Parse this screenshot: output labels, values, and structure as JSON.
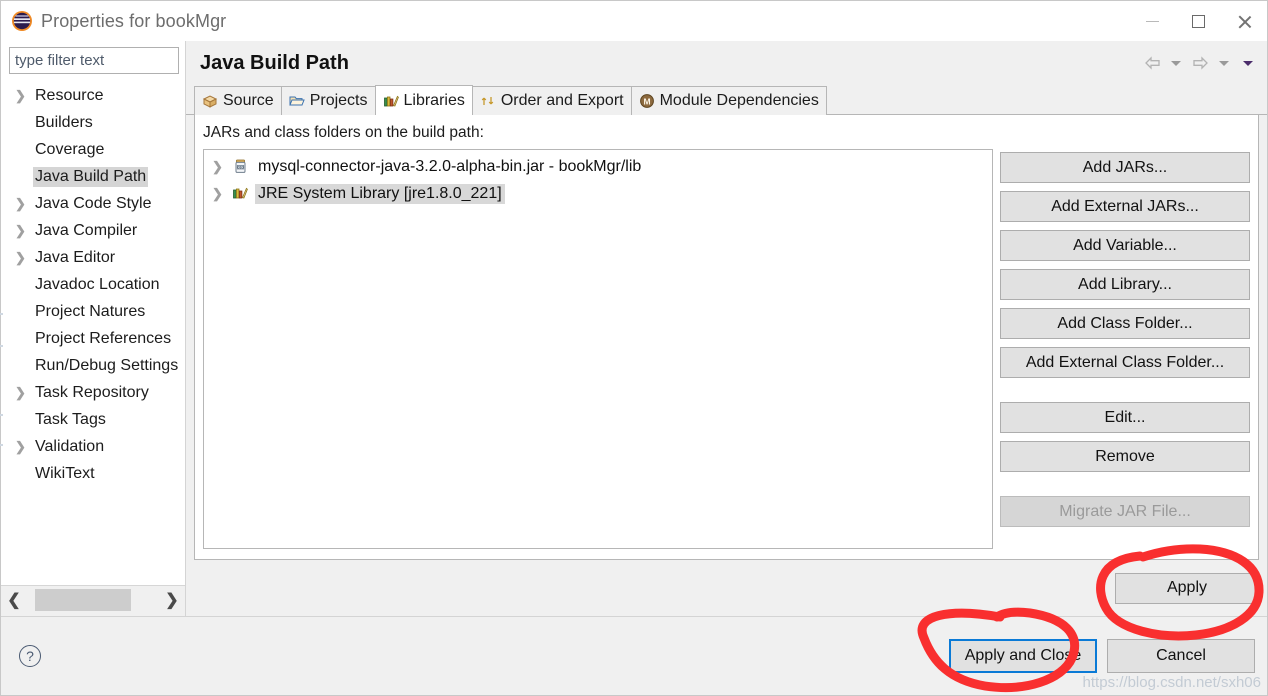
{
  "window": {
    "title": "Properties for bookMgr",
    "icon": "eclipse-logo",
    "controls": {
      "minimize": "minimize-icon",
      "maximize": "maximize-icon",
      "close": "close-icon"
    }
  },
  "sidebar": {
    "filter": {
      "value": "",
      "placeholder": "type filter text"
    },
    "items": [
      {
        "label": "Resource",
        "expandable": true,
        "selected": false
      },
      {
        "label": "Builders",
        "expandable": false,
        "selected": false
      },
      {
        "label": "Coverage",
        "expandable": false,
        "selected": false
      },
      {
        "label": "Java Build Path",
        "expandable": false,
        "selected": true
      },
      {
        "label": "Java Code Style",
        "expandable": true,
        "selected": false
      },
      {
        "label": "Java Compiler",
        "expandable": true,
        "selected": false
      },
      {
        "label": "Java Editor",
        "expandable": true,
        "selected": false
      },
      {
        "label": "Javadoc Location",
        "expandable": false,
        "selected": false
      },
      {
        "label": "Project Natures",
        "expandable": false,
        "selected": false
      },
      {
        "label": "Project References",
        "expandable": false,
        "selected": false
      },
      {
        "label": "Run/Debug Settings",
        "expandable": false,
        "selected": false
      },
      {
        "label": "Task Repository",
        "expandable": true,
        "selected": false
      },
      {
        "label": "Task Tags",
        "expandable": false,
        "selected": false
      },
      {
        "label": "Validation",
        "expandable": true,
        "selected": false
      },
      {
        "label": "WikiText",
        "expandable": false,
        "selected": false
      }
    ],
    "scrollbar": {
      "left_arrow": "chevron-left-icon",
      "right_arrow": "chevron-right-icon"
    }
  },
  "page": {
    "title": "Java Build Path",
    "nav": {
      "back": "back-arrow-icon",
      "back_menu": "chevron-down-icon",
      "forward": "forward-arrow-icon",
      "forward_menu": "chevron-down-icon",
      "view_menu": "chevron-down-icon"
    },
    "tabs": [
      {
        "label": "Source",
        "icon": "package-icon",
        "active": false
      },
      {
        "label": "Projects",
        "icon": "folder-icon",
        "active": false
      },
      {
        "label": "Libraries",
        "icon": "books-icon",
        "active": true
      },
      {
        "label": "Order and Export",
        "icon": "order-arrows-icon",
        "active": false
      },
      {
        "label": "Module Dependencies",
        "icon": "module-icon",
        "active": false
      }
    ],
    "content": {
      "label": "JARs and class folders on the build path:",
      "entries": [
        {
          "label": "mysql-connector-java-3.2.0-alpha-bin.jar - bookMgr/lib",
          "icon": "jar-icon",
          "expandable": true,
          "selected": false
        },
        {
          "label": "JRE System Library [jre1.8.0_221]",
          "icon": "books-icon",
          "expandable": true,
          "selected": true
        }
      ],
      "buttons": [
        {
          "label": "Add JARs...",
          "enabled": true,
          "spaced": false
        },
        {
          "label": "Add External JARs...",
          "enabled": true,
          "spaced": false
        },
        {
          "label": "Add Variable...",
          "enabled": true,
          "spaced": false
        },
        {
          "label": "Add Library...",
          "enabled": true,
          "spaced": false
        },
        {
          "label": "Add Class Folder...",
          "enabled": true,
          "spaced": false
        },
        {
          "label": "Add External Class Folder...",
          "enabled": true,
          "spaced": false
        },
        {
          "label": "Edit...",
          "enabled": true,
          "spaced": true
        },
        {
          "label": "Remove",
          "enabled": true,
          "spaced": false
        },
        {
          "label": "Migrate JAR File...",
          "enabled": false,
          "spaced": true
        }
      ]
    },
    "apply_label": "Apply"
  },
  "footer": {
    "help": "help-icon",
    "apply_and_close_label": "Apply and Close",
    "cancel_label": "Cancel"
  },
  "annotations": {
    "color": "#f92f2f",
    "shapes": [
      "circle-around-apply",
      "circle-around-apply-and-close"
    ]
  },
  "watermark": "https://blog.csdn.net/sxh06"
}
